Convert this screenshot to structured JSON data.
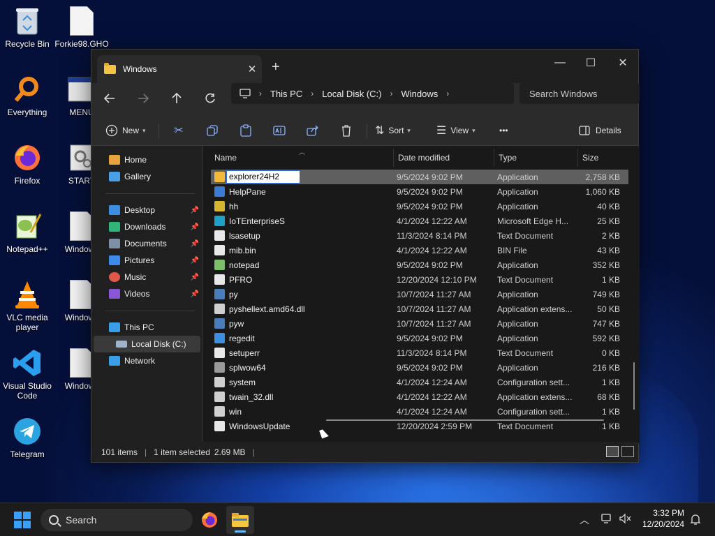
{
  "desktop": {
    "icons": [
      {
        "label": "Recycle Bin"
      },
      {
        "label": "Forkie98.GHO"
      },
      {
        "label": "Everything"
      },
      {
        "label": "MENU"
      },
      {
        "label": "Firefox"
      },
      {
        "label": "START"
      },
      {
        "label": "Notepad++"
      },
      {
        "label": "Windows"
      },
      {
        "label": "VLC media player"
      },
      {
        "label": "Windows"
      },
      {
        "label": "Visual Studio Code"
      },
      {
        "label": "Windows"
      },
      {
        "label": "Telegram"
      }
    ]
  },
  "window": {
    "tab_title": "Windows",
    "close_tab": "✕",
    "new_tab": "+",
    "controls": {
      "minimize": "—",
      "maximize": "☐",
      "close": "✕"
    },
    "breadcrumbs": [
      "This PC",
      "Local Disk (C:)",
      "Windows"
    ],
    "search_placeholder": "Search Windows"
  },
  "commands": {
    "new_label": "New",
    "sort_label": "Sort",
    "view_label": "View",
    "more_label": "•••",
    "details_label": "Details"
  },
  "sidebar": {
    "top": [
      {
        "label": "Home",
        "icon": "home-icon",
        "color": "#e8a33c"
      },
      {
        "label": "Gallery",
        "icon": "gallery-icon",
        "color": "#4aa0e6"
      }
    ],
    "pinned": [
      {
        "label": "Desktop",
        "icon": "desktop-icon",
        "color": "#3b8ee0"
      },
      {
        "label": "Downloads",
        "icon": "downloads-icon",
        "color": "#2fb57a"
      },
      {
        "label": "Documents",
        "icon": "documents-icon",
        "color": "#7f8fa6"
      },
      {
        "label": "Pictures",
        "icon": "pictures-icon",
        "color": "#3d8be8"
      },
      {
        "label": "Music",
        "icon": "music-icon",
        "color": "#e0584a"
      },
      {
        "label": "Videos",
        "icon": "videos-icon",
        "color": "#8a58d6"
      }
    ],
    "pc": [
      {
        "label": "This PC",
        "icon": "this-pc-icon",
        "color": "#3a9ee8"
      },
      {
        "label": "Local Disk (C:)",
        "icon": "local-disk-icon",
        "color": "#9fb4c8"
      },
      {
        "label": "Network",
        "icon": "network-icon",
        "color": "#3a9ee8"
      }
    ]
  },
  "columns": {
    "name": "Name",
    "date": "Date modified",
    "type": "Type",
    "size": "Size"
  },
  "files": [
    {
      "name": "explorer24H2",
      "date": "9/5/2024 9:02 PM",
      "type": "Application",
      "size": "2,758 KB",
      "color": "#f2b93b",
      "renaming": true
    },
    {
      "name": "HelpPane",
      "date": "9/5/2024 9:02 PM",
      "type": "Application",
      "size": "1,060 KB",
      "color": "#3a7bd5"
    },
    {
      "name": "hh",
      "date": "9/5/2024 9:02 PM",
      "type": "Application",
      "size": "40 KB",
      "color": "#d6b531"
    },
    {
      "name": "IoTEnterpriseS",
      "date": "4/1/2024 12:22 AM",
      "type": "Microsoft Edge H...",
      "size": "25 KB",
      "color": "#1fa0c9"
    },
    {
      "name": "lsasetup",
      "date": "11/3/2024 8:14 PM",
      "type": "Text Document",
      "size": "2 KB",
      "color": "#e8e8e8"
    },
    {
      "name": "mib.bin",
      "date": "4/1/2024 12:22 AM",
      "type": "BIN File",
      "size": "43 KB",
      "color": "#e8e8e8"
    },
    {
      "name": "notepad",
      "date": "9/5/2024 9:02 PM",
      "type": "Application",
      "size": "352 KB",
      "color": "#7bbf6a"
    },
    {
      "name": "PFRO",
      "date": "12/20/2024 12:10 PM",
      "type": "Text Document",
      "size": "1 KB",
      "color": "#e8e8e8"
    },
    {
      "name": "py",
      "date": "10/7/2024 11:27 AM",
      "type": "Application",
      "size": "749 KB",
      "color": "#4a7ebb"
    },
    {
      "name": "pyshellext.amd64.dll",
      "date": "10/7/2024 11:27 AM",
      "type": "Application extens...",
      "size": "50 KB",
      "color": "#cfcfcf"
    },
    {
      "name": "pyw",
      "date": "10/7/2024 11:27 AM",
      "type": "Application",
      "size": "747 KB",
      "color": "#4a7ebb"
    },
    {
      "name": "regedit",
      "date": "9/5/2024 9:02 PM",
      "type": "Application",
      "size": "592 KB",
      "color": "#3b8ee0"
    },
    {
      "name": "setuperr",
      "date": "11/3/2024 8:14 PM",
      "type": "Text Document",
      "size": "0 KB",
      "color": "#e8e8e8"
    },
    {
      "name": "splwow64",
      "date": "9/5/2024 9:02 PM",
      "type": "Application",
      "size": "216 KB",
      "color": "#9a9a9a"
    },
    {
      "name": "system",
      "date": "4/1/2024 12:24 AM",
      "type": "Configuration sett...",
      "size": "1 KB",
      "color": "#cfcfcf"
    },
    {
      "name": "twain_32.dll",
      "date": "4/1/2024 12:22 AM",
      "type": "Application extens...",
      "size": "68 KB",
      "color": "#cfcfcf"
    },
    {
      "name": "win",
      "date": "4/1/2024 12:24 AM",
      "type": "Configuration sett...",
      "size": "1 KB",
      "color": "#cfcfcf"
    },
    {
      "name": "WindowsUpdate",
      "date": "12/20/2024 2:59 PM",
      "type": "Text Document",
      "size": "1 KB",
      "color": "#e8e8e8"
    }
  ],
  "status": {
    "items": "101 items",
    "selected": "1 item selected",
    "size": "2.69 MB"
  },
  "taskbar": {
    "search_label": "Search",
    "time": "3:32 PM",
    "date": "12/20/2024"
  }
}
